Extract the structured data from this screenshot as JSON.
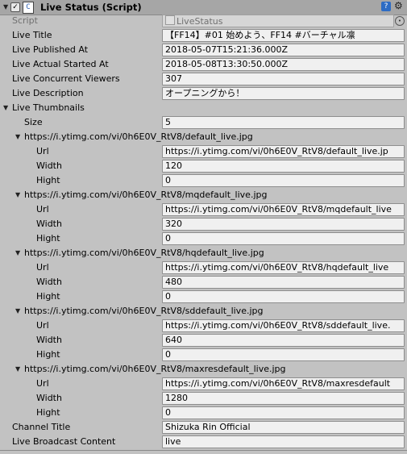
{
  "header": {
    "title": "Live Status (Script)",
    "icons": {
      "fold": "triangle-down",
      "enabled": "checkbox-checked",
      "script": "script-icon",
      "help": "help-icon",
      "settings": "gear-icon"
    }
  },
  "script_field": {
    "label": "Script",
    "value": "LiveStatus"
  },
  "fields": {
    "live_title": {
      "label": "Live Title",
      "value": "【FF14】#01 始めよう、FF14 #バーチャル凛"
    },
    "published_at": {
      "label": "Live Published At",
      "value": "2018-05-07T15:21:36.000Z"
    },
    "actual_started_at": {
      "label": "Live Actual Started At",
      "value": "2018-05-08T13:30:50.000Z"
    },
    "concurrent_viewers": {
      "label": "Live Concurrent Viewers",
      "value": "307"
    },
    "description": {
      "label": "Live Description",
      "value": "オープニングから！"
    },
    "channel_title": {
      "label": "Channel Title",
      "value": "Shizuka Rin Official"
    },
    "broadcast_content": {
      "label": "Live Broadcast Content",
      "value": "live"
    }
  },
  "thumbnails": {
    "label": "Live Thumbnails",
    "size_label": "Size",
    "size_value": "5",
    "sub_labels": {
      "url": "Url",
      "width": "Width",
      "hight": "Hight"
    },
    "items": [
      {
        "header": "https://i.ytimg.com/vi/0h6E0V_RtV8/default_live.jpg",
        "url": "https://i.ytimg.com/vi/0h6E0V_RtV8/default_live.jp",
        "width": "120",
        "hight": "0"
      },
      {
        "header": "https://i.ytimg.com/vi/0h6E0V_RtV8/mqdefault_live.jpg",
        "url": "https://i.ytimg.com/vi/0h6E0V_RtV8/mqdefault_live",
        "width": "320",
        "hight": "0"
      },
      {
        "header": "https://i.ytimg.com/vi/0h6E0V_RtV8/hqdefault_live.jpg",
        "url": "https://i.ytimg.com/vi/0h6E0V_RtV8/hqdefault_live",
        "width": "480",
        "hight": "0"
      },
      {
        "header": "https://i.ytimg.com/vi/0h6E0V_RtV8/sddefault_live.jpg",
        "url": "https://i.ytimg.com/vi/0h6E0V_RtV8/sddefault_live.",
        "width": "640",
        "hight": "0"
      },
      {
        "header": "https://i.ytimg.com/vi/0h6E0V_RtV8/maxresdefault_live.jpg",
        "url": "https://i.ytimg.com/vi/0h6E0V_RtV8/maxresdefault",
        "width": "1280",
        "hight": "0"
      }
    ]
  }
}
